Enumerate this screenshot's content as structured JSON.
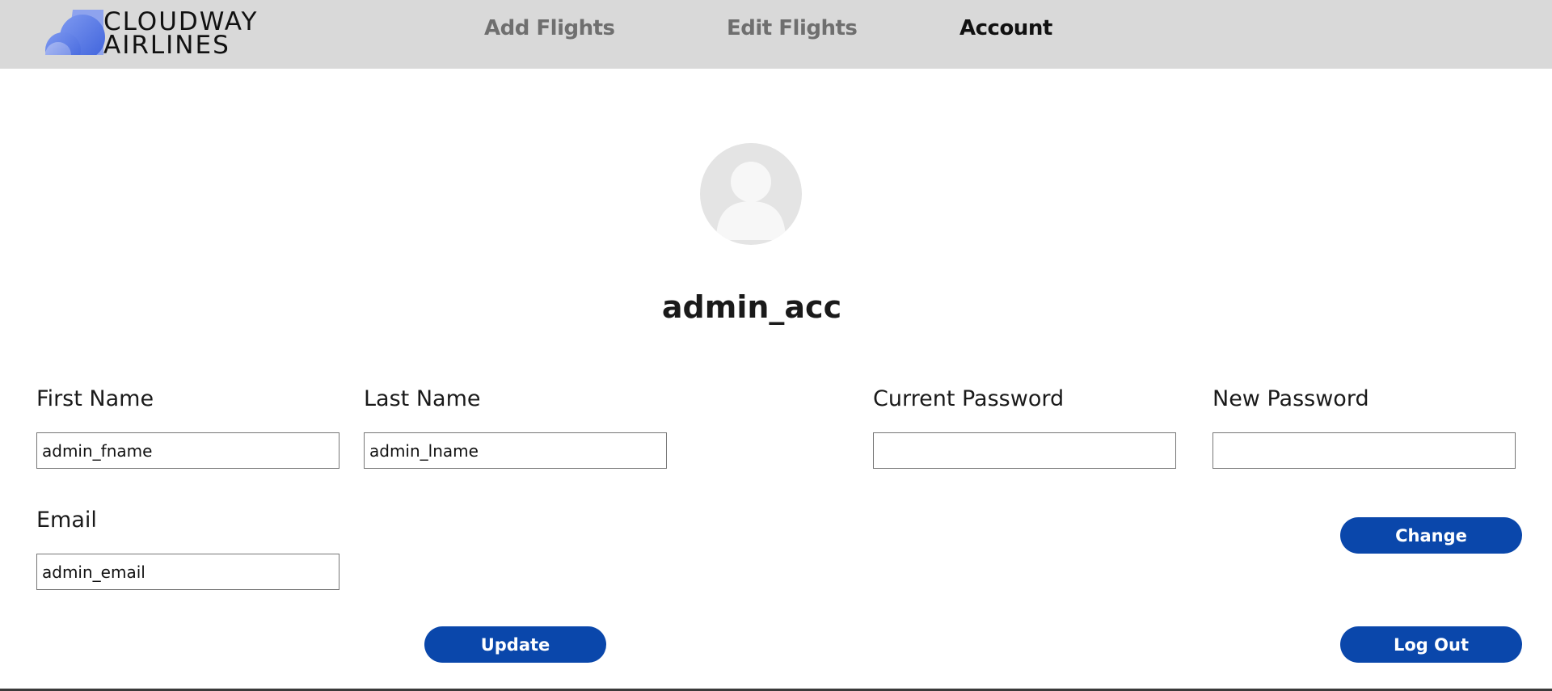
{
  "brand": {
    "line1": "CLOUDWAY",
    "line2": "AIRLINES",
    "logo_icon": "cloud-icon",
    "accent": "#4a6fe0"
  },
  "nav": {
    "add_flights": "Add Flights",
    "edit_flights": "Edit Flights",
    "account": "Account"
  },
  "profile": {
    "avatar_icon": "user-avatar-icon",
    "username": "admin_acc"
  },
  "form": {
    "first_name_label": "First Name",
    "first_name_value": "admin_fname",
    "last_name_label": "Last Name",
    "last_name_value": "admin_lname",
    "email_label": "Email",
    "email_value": "admin_email",
    "current_password_label": "Current Password",
    "current_password_value": "",
    "new_password_label": "New Password",
    "new_password_value": ""
  },
  "buttons": {
    "change": "Change",
    "update": "Update",
    "logout": "Log Out",
    "color": "#0a47ab"
  }
}
